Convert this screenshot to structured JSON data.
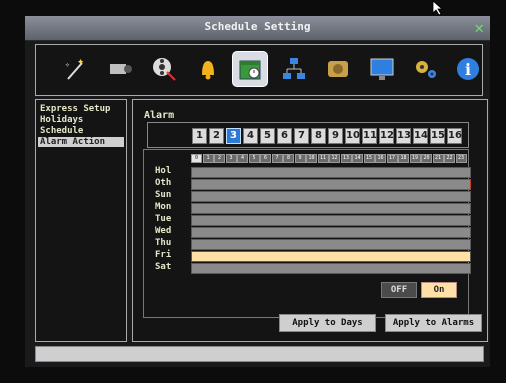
{
  "window": {
    "title": "Schedule Setting"
  },
  "toolbar": {
    "icons": [
      {
        "name": "wand-icon"
      },
      {
        "name": "camera-icon"
      },
      {
        "name": "film-reel-icon"
      },
      {
        "name": "bell-icon"
      },
      {
        "name": "calendar-icon",
        "selected": true
      },
      {
        "name": "network-icon"
      },
      {
        "name": "hdd-icon"
      },
      {
        "name": "monitor-icon"
      },
      {
        "name": "gears-icon"
      },
      {
        "name": "info-icon"
      }
    ]
  },
  "sidebar": {
    "items": [
      {
        "label": "Express Setup"
      },
      {
        "label": "Holidays"
      },
      {
        "label": "Schedule"
      },
      {
        "label": "Alarm Action",
        "selected": true
      }
    ]
  },
  "alarm": {
    "label": "Alarm",
    "buttons": [
      "1",
      "2",
      "3",
      "4",
      "5",
      "6",
      "7",
      "8",
      "9",
      "10",
      "11",
      "12",
      "13",
      "14",
      "15",
      "16"
    ],
    "selected": "3"
  },
  "schedule": {
    "hours": [
      "0",
      "1",
      "2",
      "3",
      "4",
      "5",
      "6",
      "7",
      "8",
      "9",
      "10",
      "11",
      "12",
      "13",
      "14",
      "15",
      "16",
      "17",
      "18",
      "19",
      "20",
      "21",
      "22",
      "23"
    ],
    "days": [
      {
        "label": "Hol"
      },
      {
        "label": "Oth",
        "highlight": "red"
      },
      {
        "label": "Sun"
      },
      {
        "label": "Mon"
      },
      {
        "label": "Tue"
      },
      {
        "label": "Wed"
      },
      {
        "label": "Thu"
      },
      {
        "label": "Fri",
        "highlight": "on"
      },
      {
        "label": "Sat"
      }
    ]
  },
  "toggle": {
    "off_label": "OFF",
    "on_label": "On"
  },
  "actions": {
    "apply_days": "Apply to Days",
    "apply_alarms": "Apply to Alarms"
  }
}
